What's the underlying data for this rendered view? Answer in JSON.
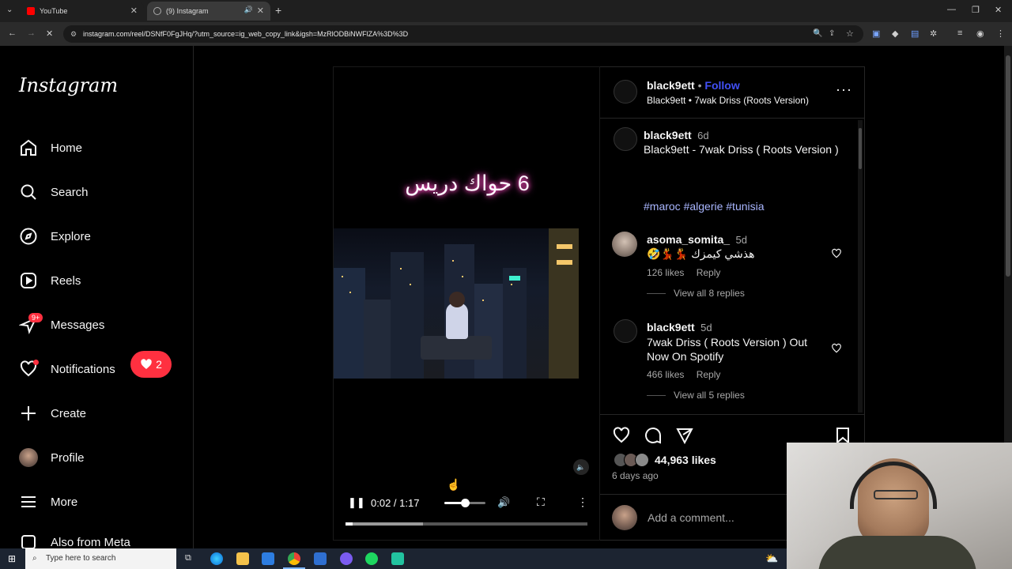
{
  "browser": {
    "tabs": [
      {
        "label": "YouTube",
        "active": false
      },
      {
        "label": "(9) Instagram",
        "active": true
      }
    ],
    "url": "instagram.com/reel/DSNfF0FgJHq/?utm_source=ig_web_copy_link&igsh=MzRlODBiNWFlZA%3D%3D"
  },
  "sidebar": {
    "logo": "Instagram",
    "items": [
      {
        "label": "Home",
        "icon": "home-icon"
      },
      {
        "label": "Search",
        "icon": "search-icon"
      },
      {
        "label": "Explore",
        "icon": "compass-icon"
      },
      {
        "label": "Reels",
        "icon": "reels-icon"
      },
      {
        "label": "Messages",
        "icon": "messenger-icon"
      },
      {
        "label": "Notifications",
        "icon": "heart-icon"
      },
      {
        "label": "Create",
        "icon": "plus-icon"
      },
      {
        "label": "Profile",
        "icon": "avatar"
      },
      {
        "label": "More",
        "icon": "menu-icon"
      },
      {
        "label": "Also from Meta",
        "icon": "meta-icon"
      }
    ],
    "messages_badge": "9+",
    "notifications_count": "2"
  },
  "reel": {
    "overlay_text": "6 حواك دريس",
    "time": "0:02 / 1:17",
    "progress": 0.03,
    "volume": 0.5
  },
  "post": {
    "username": "black9ett",
    "follow": "Follow",
    "separator": "•",
    "audio": "Black9ett • 7wak Driss (Roots Version)",
    "caption_user": "black9ett",
    "caption_age": "6d",
    "caption": "Black9ett - 7wak Driss ( Roots Version )",
    "hashtags": "#maroc #algerie #tunisia",
    "likes": "44,963 likes",
    "date": "6 days ago",
    "add_comment": "Add a comment..."
  },
  "comments": [
    {
      "user": "asoma_somita_",
      "age": "5d",
      "text": "🤣💃💃 هذشي كيمزك",
      "likes": "126 likes",
      "reply": "Reply",
      "view_replies": "View all 8 replies"
    },
    {
      "user": "black9ett",
      "age": "5d",
      "text": "7wak Driss ( Roots Version ) Out Now On Spotify",
      "likes": "466 likes",
      "reply": "Reply",
      "view_replies": "View all 5 replies"
    }
  ],
  "taskbar": {
    "search_placeholder": "Type here to search"
  },
  "colors": {
    "follow": "#4150f7",
    "hashtag": "#a9b6ff",
    "notification_badge": "#ff3040"
  }
}
